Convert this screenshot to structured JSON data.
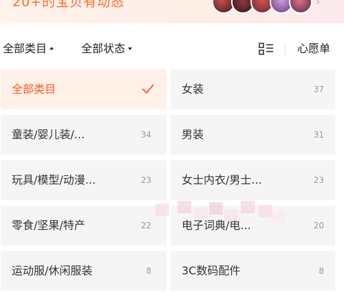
{
  "banner": {
    "text": "20+的宝贝有动态",
    "arrow": "›"
  },
  "filters": {
    "category": "全部类目",
    "status": "全部状态",
    "wishlist": "心愿单"
  },
  "categories": [
    {
      "label": "全部类目",
      "count": "",
      "selected": true
    },
    {
      "label": "女装",
      "count": "37"
    },
    {
      "label": "童装/婴儿装/...",
      "count": "34"
    },
    {
      "label": "男装",
      "count": "31"
    },
    {
      "label": "玩具/模型/动漫...",
      "count": "23"
    },
    {
      "label": "女士内衣/男士...",
      "count": "23"
    },
    {
      "label": "零食/坚果/特产",
      "count": "22"
    },
    {
      "label": "电子词典/电...",
      "count": "20"
    },
    {
      "label": "运动服/休闲服装",
      "count": "8"
    },
    {
      "label": "3C数码配件",
      "count": "8"
    }
  ],
  "colors": {
    "accent": "#ff5a1f",
    "selected_bg": "#fff0e8",
    "cell_bg": "#f5f5f5"
  }
}
